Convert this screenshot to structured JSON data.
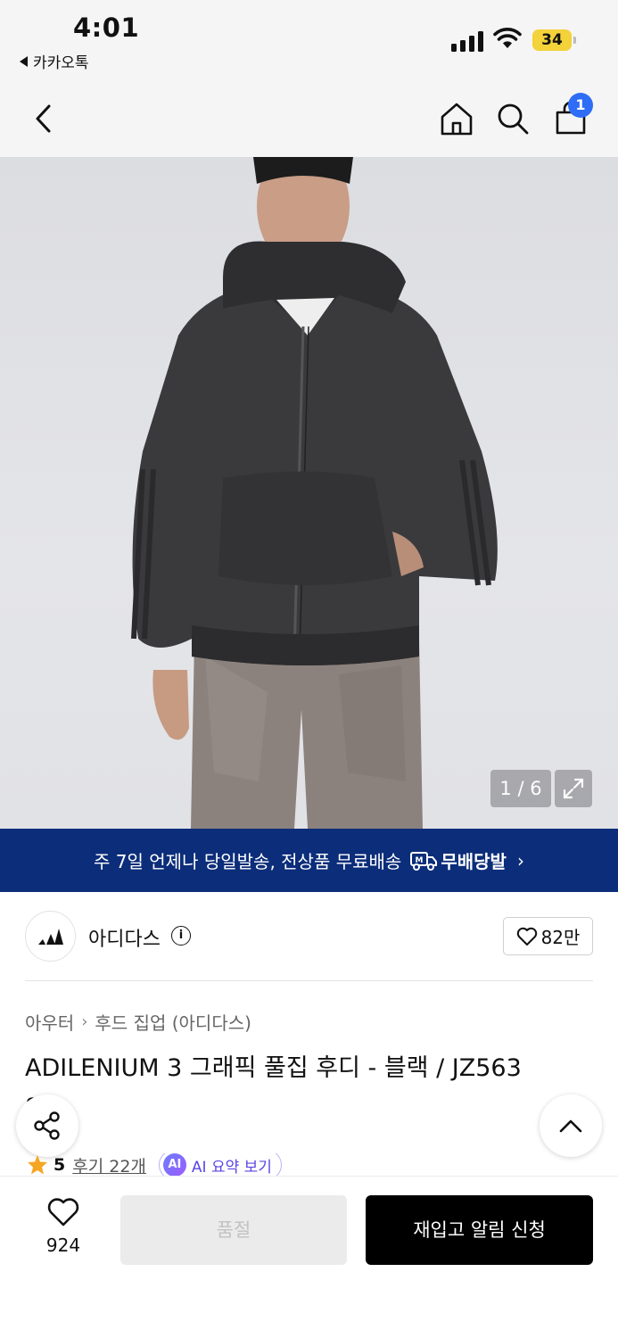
{
  "status_bar": {
    "time": "4:01",
    "back_app": "카카오톡",
    "battery": "34"
  },
  "header": {
    "cart_count": "1"
  },
  "gallery": {
    "counter": "1 / 6"
  },
  "banner": {
    "text": "주 7일 언제나 당일발송, 전상품 무료배송",
    "badge": "무배당발",
    "bg_color": "#0c2d7a"
  },
  "brand": {
    "name": "아디다스",
    "like_count": "82만"
  },
  "breadcrumb": {
    "items": [
      "아우터",
      "후드 집업 (아디다스)"
    ]
  },
  "product": {
    "title": "ADILENIUM 3 그래픽 풀집 후디 - 블랙 / JZ563",
    "title_overflow": "8"
  },
  "rating": {
    "score": "5",
    "reviews": "후기 22개",
    "ai_badge": "AI",
    "ai_summary": "AI 요약 보기",
    "star_color": "#f5a623"
  },
  "bottom": {
    "wish_count": "924",
    "soldout_label": "품절",
    "restock_label": "재입고 알림 신청"
  }
}
